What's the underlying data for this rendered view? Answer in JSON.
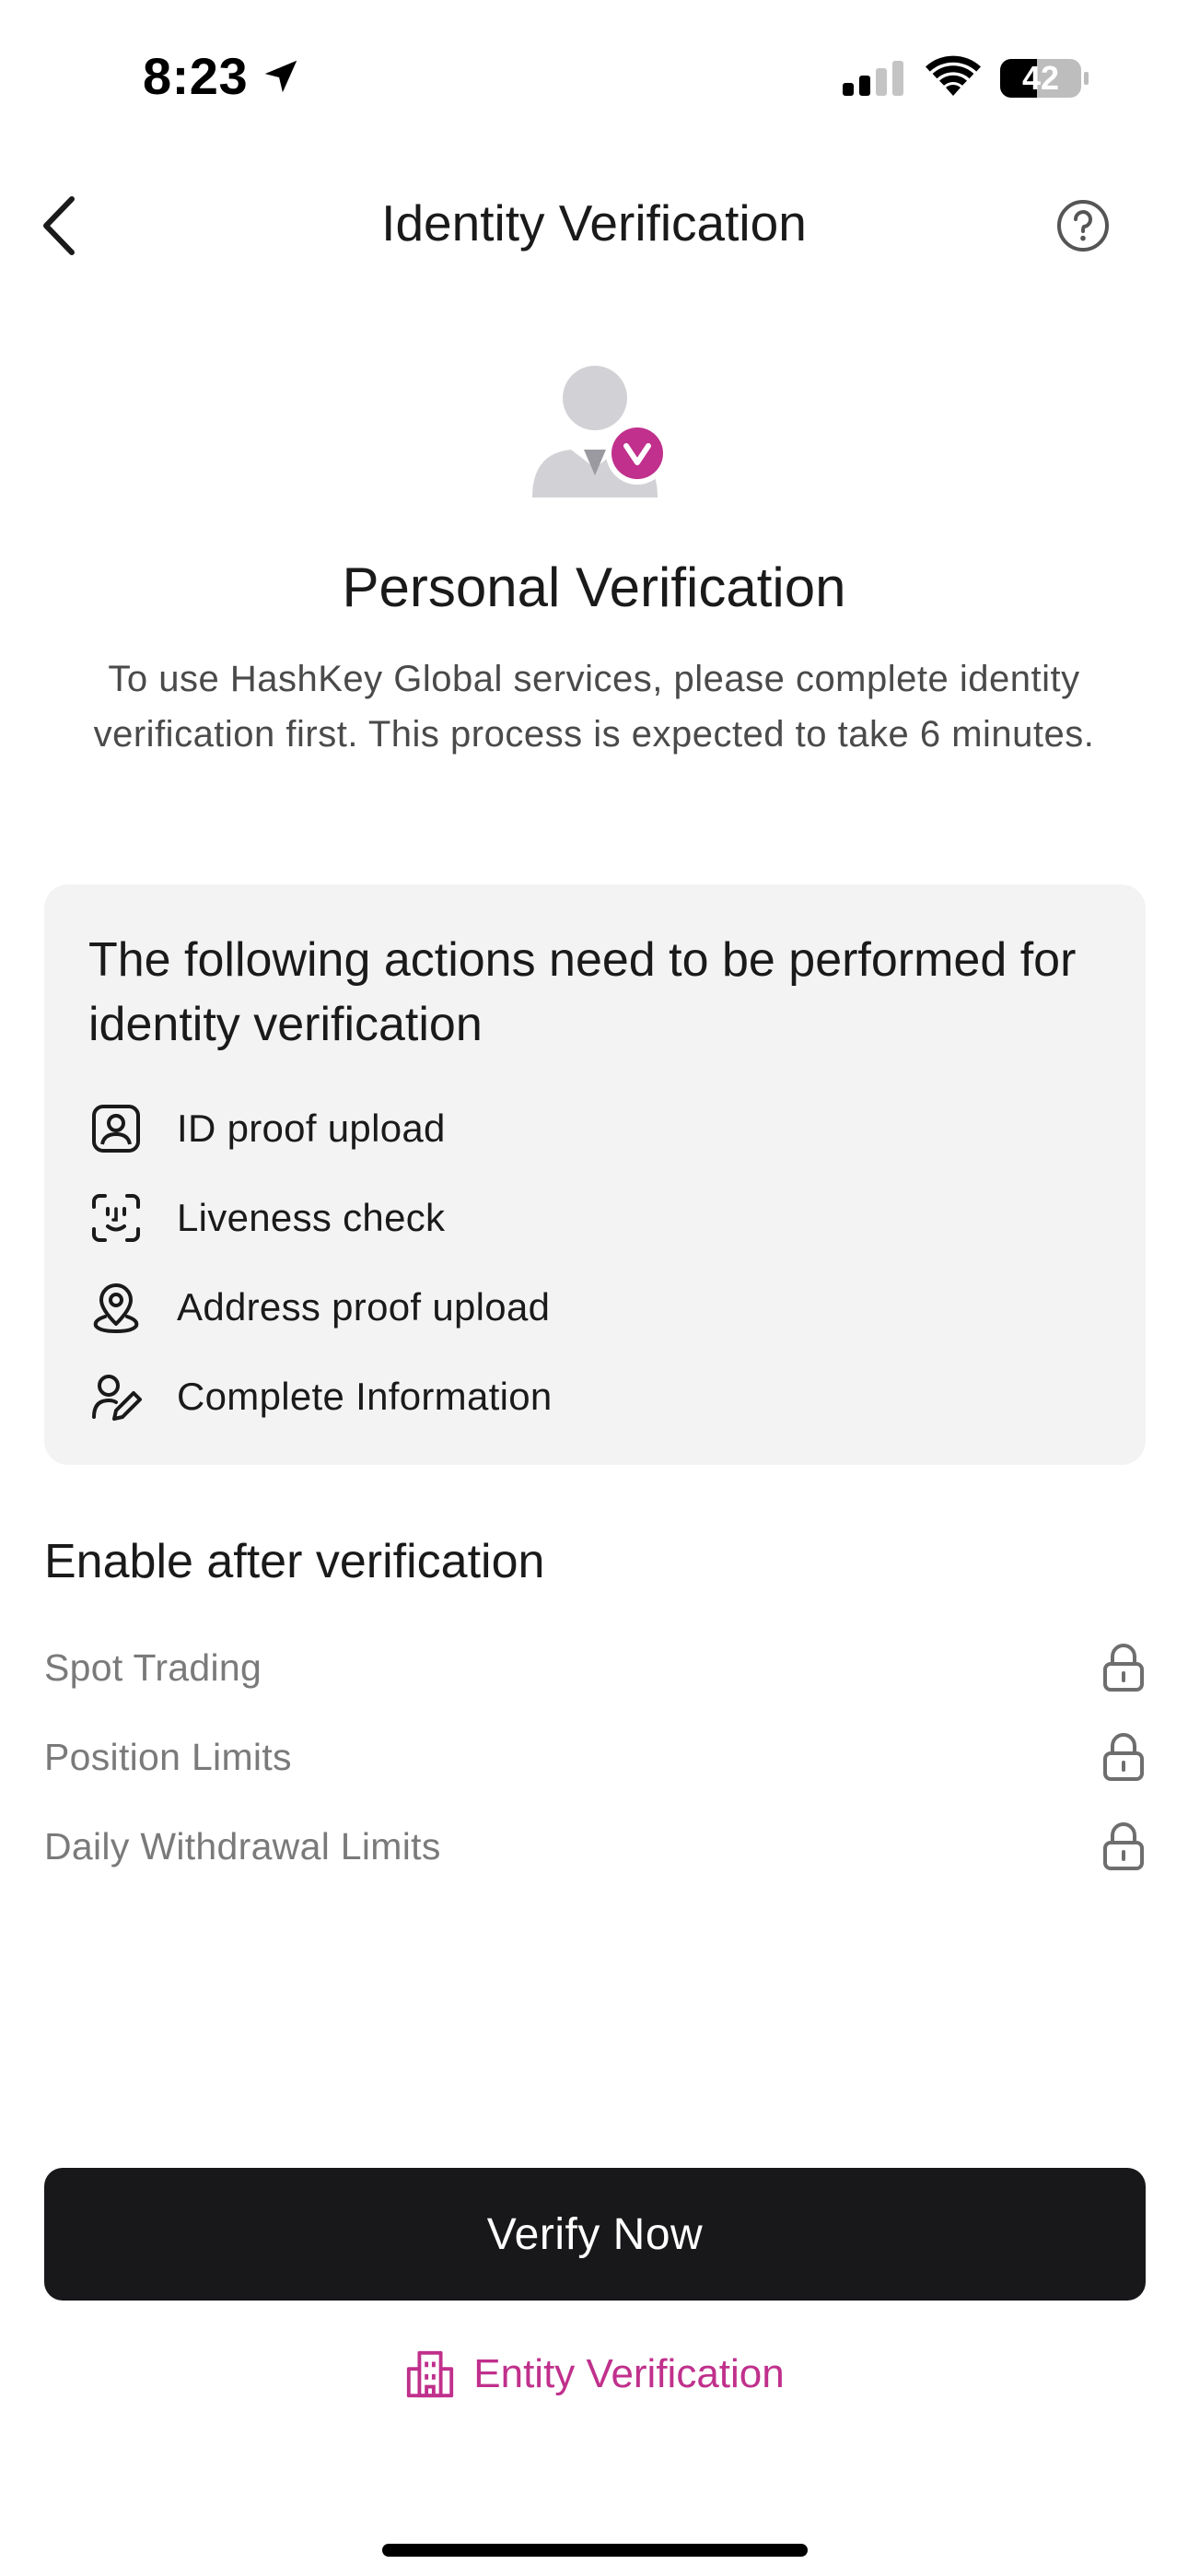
{
  "status_bar": {
    "time": "8:23",
    "battery_level": "42"
  },
  "nav": {
    "title": "Identity Verification"
  },
  "hero": {
    "title": "Personal Verification",
    "description": "To use HashKey Global services, please complete identity verification first. This process is expected to take 6 minutes."
  },
  "actions": {
    "title": "The following actions need to be performed for identity verification",
    "items": [
      {
        "label": "ID proof upload",
        "icon": "id-card-icon"
      },
      {
        "label": "Liveness check",
        "icon": "face-scan-icon"
      },
      {
        "label": "Address proof upload",
        "icon": "location-pin-icon"
      },
      {
        "label": "Complete Information",
        "icon": "user-edit-icon"
      }
    ]
  },
  "permissions": {
    "title": "Enable after verification",
    "items": [
      {
        "label": "Spot Trading",
        "icon": "lock-icon"
      },
      {
        "label": "Position Limits",
        "icon": "lock-icon"
      },
      {
        "label": "Daily Withdrawal Limits",
        "icon": "lock-icon"
      }
    ]
  },
  "buttons": {
    "verify": "Verify Now",
    "entity": "Entity Verification"
  },
  "colors": {
    "accent": "#c0308c",
    "primary_button": "#18181a",
    "card_bg": "#f3f3f3"
  }
}
